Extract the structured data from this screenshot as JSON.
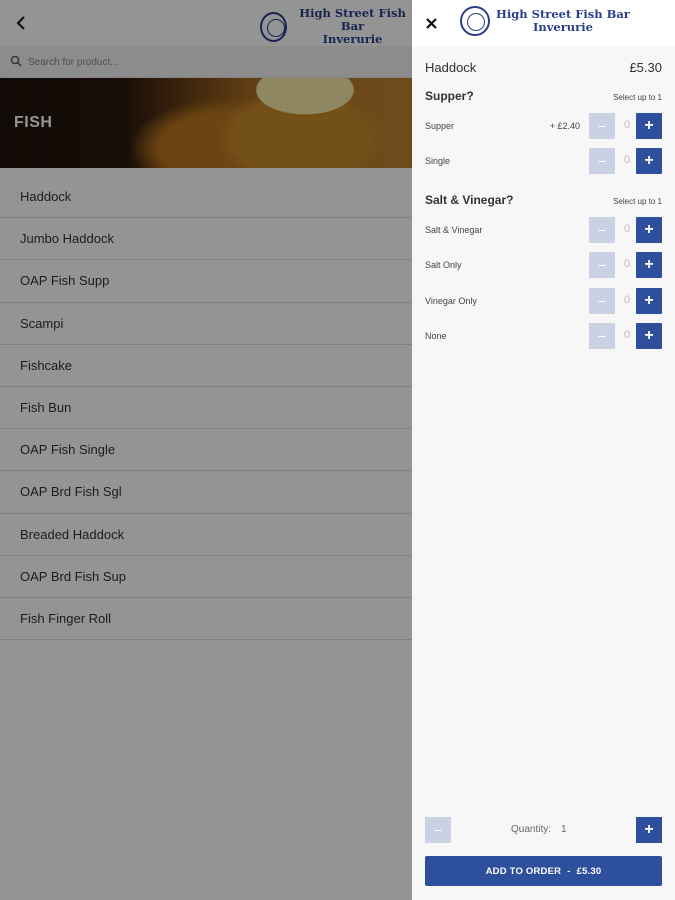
{
  "brand": {
    "line1": "High Street Fish Bar",
    "line2": "Inverurie",
    "color": "#2a3f8a"
  },
  "search": {
    "placeholder": "Search for product..."
  },
  "category": {
    "title": "FISH"
  },
  "products": [
    "Haddock",
    "Jumbo Haddock",
    "OAP Fish Supp",
    "Scampi",
    "Fishcake",
    "Fish Bun",
    "OAP Fish Single",
    "OAP Brd Fish Sgl",
    "Breaded Haddock",
    "OAP Brd Fish Sup",
    "Fish Finger Roll"
  ],
  "drawer": {
    "product_name": "Haddock",
    "product_price": "£5.30",
    "groups": [
      {
        "name": "Supper?",
        "limit": "Select up to 1",
        "options": [
          {
            "label": "Supper",
            "price": "+ £2.40",
            "value": "0"
          },
          {
            "label": "Single",
            "price": "",
            "value": "0"
          }
        ]
      },
      {
        "name": "Salt & Vinegar?",
        "limit": "Select up to 1",
        "options": [
          {
            "label": "Salt & Vinegar",
            "price": "",
            "value": "0"
          },
          {
            "label": "Salt Only",
            "price": "",
            "value": "0"
          },
          {
            "label": "Vinegar Only",
            "price": "",
            "value": "0"
          },
          {
            "label": "None",
            "price": "",
            "value": "0"
          }
        ]
      }
    ],
    "quantity": {
      "label": "Quantity:",
      "value": "1"
    },
    "add_button": {
      "label": "ADD TO ORDER",
      "separator": "-",
      "total": "£5.30"
    },
    "stepper": {
      "minus": "−",
      "plus": "+"
    }
  },
  "colors": {
    "accent": "#2d4f9c",
    "accent_disabled": "#c9d1e2",
    "overlay": "rgba(0,0,0,0.42)"
  },
  "icons": {
    "back": "chevron-left-icon",
    "close": "close-icon",
    "search": "search-icon"
  }
}
